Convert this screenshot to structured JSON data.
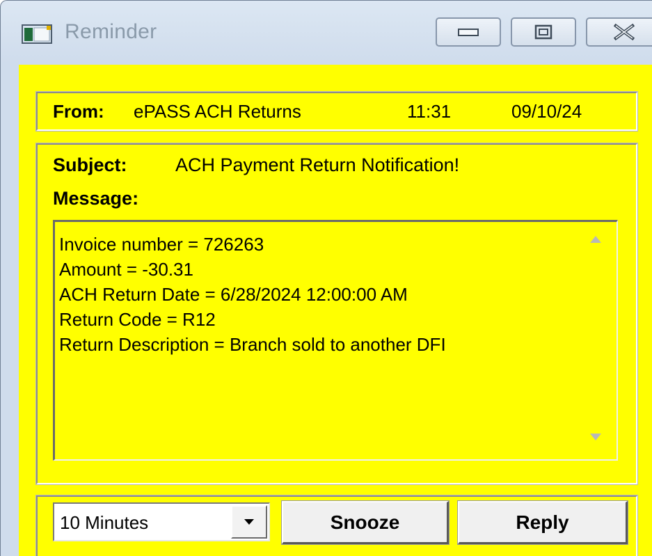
{
  "window": {
    "title": "Reminder",
    "colors": {
      "background": "#ffff00",
      "frame": "#cfdcec"
    },
    "icons": [
      "app-window-icon",
      "minimize-icon",
      "maximize-icon",
      "close-icon"
    ]
  },
  "from": {
    "label": "From:",
    "sender": "ePASS ACH Returns",
    "time": "11:31",
    "date": "09/10/24"
  },
  "subject": {
    "label": "Subject:",
    "text": "ACH Payment Return Notification!"
  },
  "message": {
    "label": "Message:",
    "lines": [
      "Invoice number = 726263",
      "Amount = -30.31",
      "ACH Return Date = 6/28/2024 12:00:00 AM",
      "Return Code = R12",
      "Return Description = Branch sold to another DFI"
    ]
  },
  "controls": {
    "snooze_interval": "10 Minutes",
    "snooze_label": "Snooze",
    "reply_label": "Reply"
  }
}
